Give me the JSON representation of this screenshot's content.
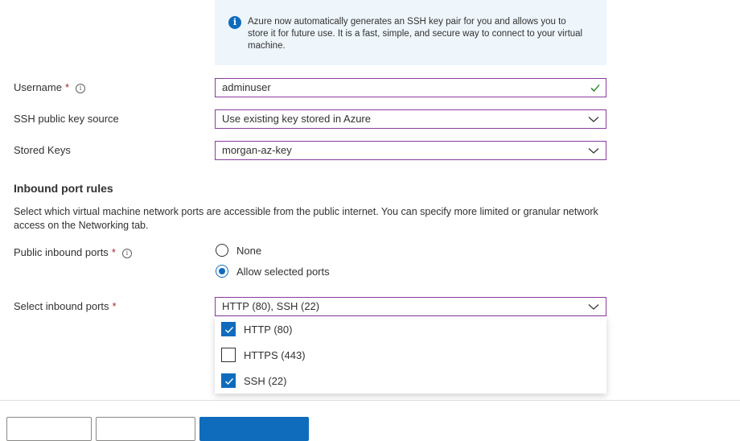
{
  "info": {
    "icon": "info-icon",
    "text": "Azure now automatically generates an SSH key pair for you and allows you to store it for future use. It is a fast, simple, and secure way to connect to your virtual machine."
  },
  "username": {
    "label": "Username",
    "required": "*",
    "value": "adminuser",
    "valid_icon": "checkmark-icon"
  },
  "ssh_source": {
    "label": "SSH public key source",
    "value": "Use existing key stored in Azure"
  },
  "stored_keys": {
    "label": "Stored Keys",
    "value": "morgan-az-key"
  },
  "inbound": {
    "title": "Inbound port rules",
    "description": "Select which virtual machine network ports are accessible from the public internet. You can specify more limited or granular network access on the Networking tab.",
    "public_ports_label": "Public inbound ports",
    "required": "*",
    "options": [
      {
        "label": "None",
        "selected": false
      },
      {
        "label": "Allow selected ports",
        "selected": true
      }
    ],
    "select_label": "Select inbound ports",
    "select_value": "HTTP (80), SSH (22)",
    "port_options": [
      {
        "label": "HTTP (80)",
        "checked": true
      },
      {
        "label": "HTTPS (443)",
        "checked": false
      },
      {
        "label": "SSH (22)",
        "checked": true
      }
    ]
  },
  "colors": {
    "accent": "#0f6cbd",
    "focus_border": "#8a3b9e",
    "required": "#a4262c",
    "info_bg": "#eef6fc"
  }
}
